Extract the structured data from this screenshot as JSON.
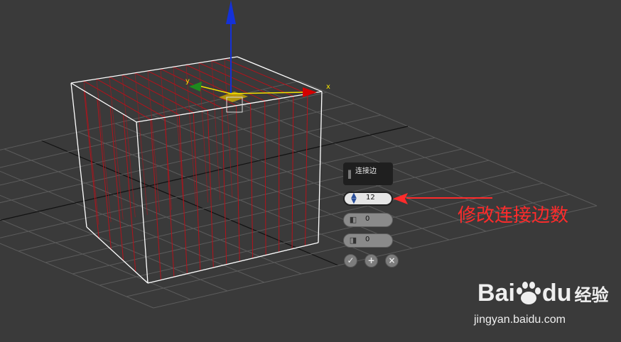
{
  "viewport": {
    "axis_x_label": "x",
    "axis_y_label": "y",
    "edge_color": "#b5121b",
    "cage_color": "#ffffff",
    "gizmo_x_color": "#d40000",
    "gizmo_y_color": "#1e8a1e",
    "gizmo_z_color": "#1431d8",
    "gizmo_plane_color": "#d8b400",
    "background_color": "#3a3a3a"
  },
  "caddy": {
    "title": "连接边",
    "grip": "||",
    "segments_value": "12",
    "slide_value": "0",
    "pinch_value": "0",
    "ok_icon": "check-icon",
    "apply_icon": "plus-icon",
    "cancel_icon": "x-icon"
  },
  "annotation": {
    "text": "修改连接边数",
    "color": "#ff2b2b"
  },
  "watermark": {
    "logo_text": "Bai",
    "logo_text2": "du",
    "logo_suffix": "经验",
    "url": "jingyan.baidu.com"
  }
}
